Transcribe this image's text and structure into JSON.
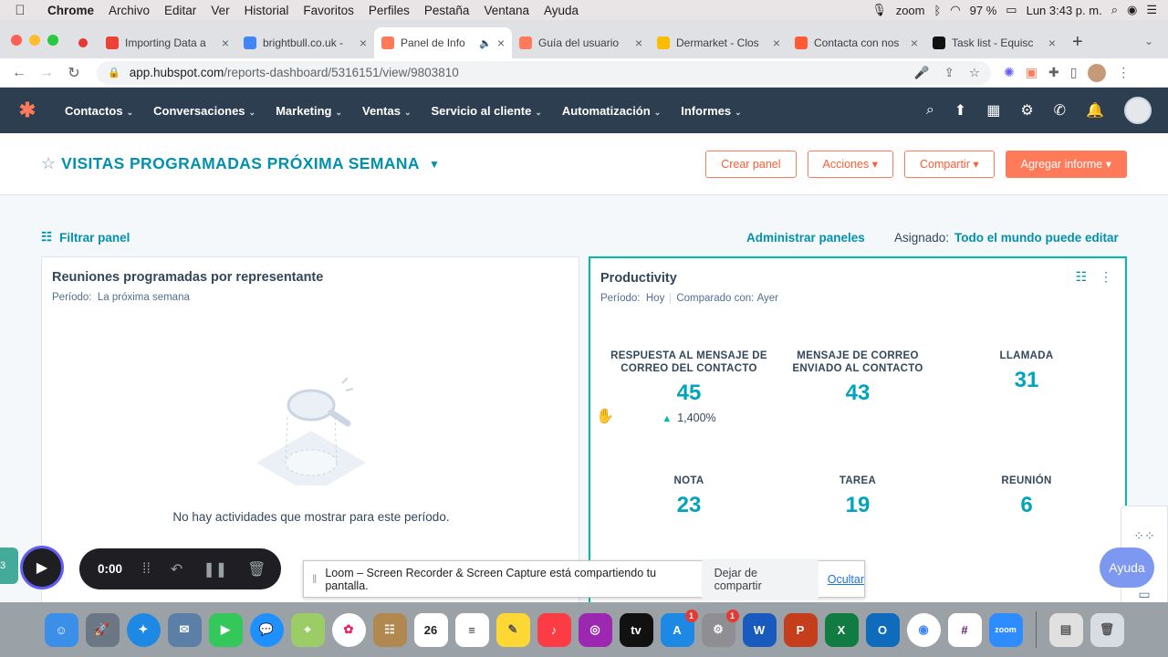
{
  "menubar": {
    "app": "Chrome",
    "items": [
      "Archivo",
      "Editar",
      "Ver",
      "Historial",
      "Favoritos",
      "Perfiles",
      "Pestaña",
      "Ventana",
      "Ayuda"
    ],
    "zoom": "zoom",
    "battery": "97 %",
    "clock": "Lun 3:43 p. m."
  },
  "tabs": [
    {
      "title": "Importing Data a",
      "color": "#ea4335",
      "active": false
    },
    {
      "title": "brightbull.co.uk -",
      "color": "#4285f4",
      "active": false
    },
    {
      "title": "Panel de Info",
      "color": "#ff7a59",
      "active": true
    },
    {
      "title": "Guía del usuario",
      "color": "#ff7a59",
      "active": false
    },
    {
      "title": "Dermarket - Clos",
      "color": "#fbbc04",
      "active": false
    },
    {
      "title": "Contacta con nos",
      "color": "#ff5c35",
      "active": false
    },
    {
      "title": "Task list - Equisc",
      "color": "#111111",
      "active": false
    }
  ],
  "address": {
    "host": "app.hubspot.com",
    "path": "/reports-dashboard/5316151/view/9803810"
  },
  "hubspot": {
    "nav": [
      "Contactos",
      "Conversaciones",
      "Marketing",
      "Ventas",
      "Servicio al cliente",
      "Automatización",
      "Informes"
    ]
  },
  "dashboard": {
    "title": "VISITAS PROGRAMADAS PRÓXIMA SEMANA",
    "buttons": {
      "create": "Crear panel",
      "actions": "Acciones",
      "share": "Compartir",
      "add": "Agregar informe"
    },
    "filter": "Filtrar panel",
    "manage": "Administrar paneles",
    "assigned_label": "Asignado:",
    "assigned_value": "Todo el mundo puede editar"
  },
  "card1": {
    "title": "Reuniones programadas por representante",
    "period_label": "Período:",
    "period_value": "La próxima semana",
    "empty": "No hay actividades que mostrar para este período."
  },
  "card2": {
    "title": "Productivity",
    "period_label": "Período:",
    "period_value": "Hoy",
    "compare_label": "Comparado con:",
    "compare_value": "Ayer",
    "metrics": [
      {
        "label": "RESPUESTA AL MENSAJE DE CORREO DEL CONTACTO",
        "value": "45",
        "change": "1,400%"
      },
      {
        "label": "MENSAJE DE CORREO ENVIADO AL CONTACTO",
        "value": "43"
      },
      {
        "label": "LLAMADA",
        "value": "31"
      },
      {
        "label": "NOTA",
        "value": "23"
      },
      {
        "label": "TAREA",
        "value": "19"
      },
      {
        "label": "REUNIÓN",
        "value": "6"
      }
    ]
  },
  "loom": {
    "time": "0:00",
    "message": "Loom – Screen Recorder & Screen Capture está compartiendo tu pantalla.",
    "stop": "Dejar de compartir",
    "hide": "Ocultar"
  },
  "help": "Ayuda",
  "dock": {
    "calendar_day": "26"
  }
}
